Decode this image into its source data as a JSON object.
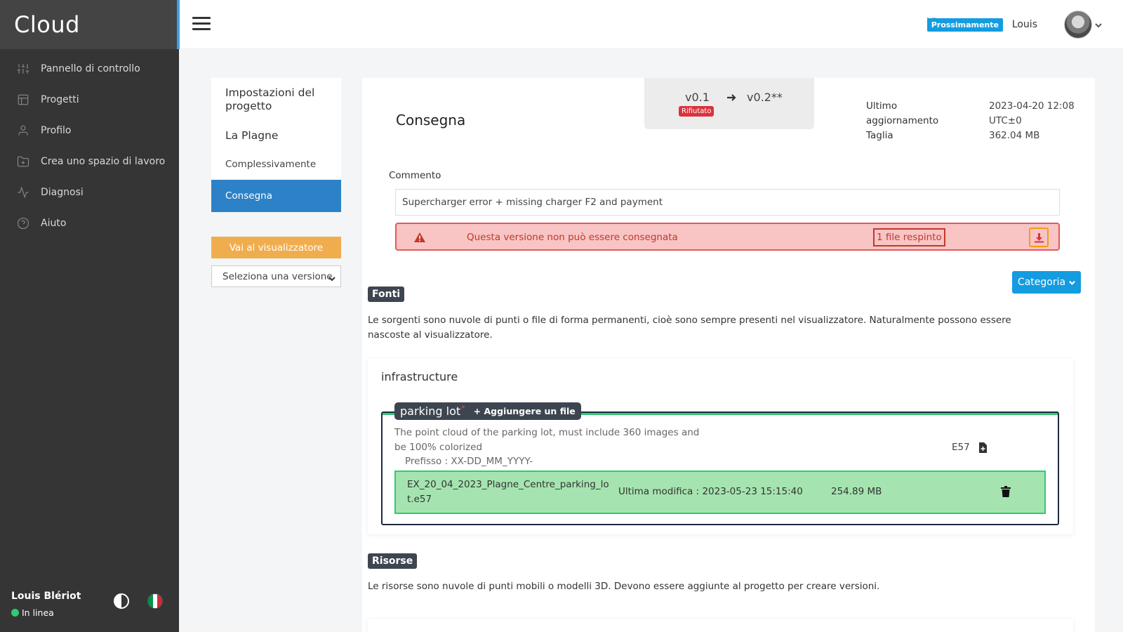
{
  "app": {
    "brand": "Cloud"
  },
  "sidebar": {
    "items": [
      {
        "label": "Pannello di controllo",
        "icon": "sliders-icon"
      },
      {
        "label": "Progetti",
        "icon": "layout-icon"
      },
      {
        "label": "Profilo",
        "icon": "user-icon"
      },
      {
        "label": "Crea uno spazio di lavoro",
        "icon": "folder-plus-icon"
      },
      {
        "label": "Diagnosi",
        "icon": "activity-icon"
      },
      {
        "label": "Aiuto",
        "icon": "help-circle-icon"
      }
    ],
    "user": {
      "name": "Louis Blériot",
      "status": "In linea"
    }
  },
  "topbar": {
    "badge": "Prossimamente",
    "user": "Louis"
  },
  "settings": {
    "title": "Impostazioni del progetto",
    "project": "La Plagne",
    "items": [
      {
        "label": "Complessivamente"
      },
      {
        "label": "Consegna"
      }
    ],
    "viewer_button": "Vai al visualizzatore",
    "version_select": "Seleziona una versione"
  },
  "delivery": {
    "title": "Consegna",
    "version_from": "v0.1",
    "version_to": "v0.2**",
    "version_status": "Rifiutato",
    "meta": {
      "updated_label_1": "Ultimo",
      "updated_label_2": "aggiornamento",
      "size_label": "Taglia",
      "updated_value_1": "2023-04-20 12:08",
      "updated_value_2": "UTC±0",
      "size_value": "362.04 MB"
    },
    "comment_label": "Commento",
    "comment_value": "Supercharger error + missing charger F2 and payment",
    "alert_message": "Questa versione non può essere consegnata",
    "alert_rejected": "1 file respinto",
    "category_button": "Categoria"
  },
  "sources": {
    "badge": "Fonti",
    "description": "Le sorgenti sono nuvole di punti o file di forma permanenti, cioè sono sempre presenti nel visualizzatore. Naturalmente possono essere nascoste al visualizzatore.",
    "group": "infrastructure",
    "item": {
      "name": "parking lot",
      "required_mark": "*",
      "add_file": "+ Aggiungere un file",
      "description": "The point cloud of the parking lot, must include 360 images and be 100% colorized",
      "prefix": "Prefisso : XX-DD_MM_YYYY-",
      "extension": "E57",
      "file": {
        "name": "EX_20_04_2023_Plagne_Centre_parking_lot.e57",
        "modified": "Ultima modifica : 2023-05-23 15:15:40",
        "size": "254.89 MB"
      }
    }
  },
  "resources": {
    "badge": "Risorse",
    "description": "Le risorse sono nuvole di punti mobili o modelli 3D. Devono essere aggiunte al progetto per creare versioni."
  },
  "colors": {
    "sidebar": "#353535",
    "accent_blue": "#139ce0",
    "active_item": "#2d82c7",
    "viewer_button": "#f0ad4e",
    "alert_bg": "#f8c4c4",
    "alert_border": "#e05a5a",
    "file_ok_bg": "#a5e4b0",
    "status_online": "#2ecc71"
  }
}
